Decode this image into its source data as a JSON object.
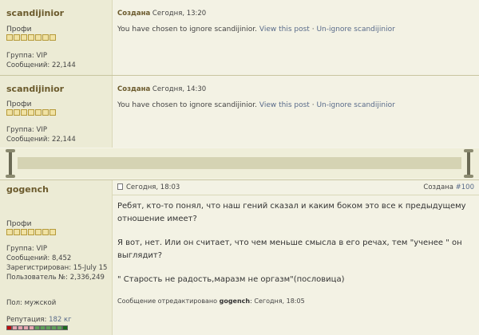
{
  "post1": {
    "username": "scandijinior",
    "rank": "Профи",
    "group": "Группа: VIP",
    "messages": "Сообщений: 22,144",
    "created_label": "Создана",
    "date": " Сегодня, 13:20",
    "ignore_text": "You have chosen to ignore scandijinior.",
    "view_link": "View this post",
    "sep": " · ",
    "unignore_link": "Un-ignore scandijinior"
  },
  "post2": {
    "username": "scandijinior",
    "rank": "Профи",
    "group": "Группа: VIP",
    "messages": "Сообщений: 22,144",
    "created_label": "Создана",
    "date": " Сегодня, 14:30",
    "ignore_text": "You have chosen to ignore scandijinior.",
    "view_link": "View this post",
    "sep": " · ",
    "unignore_link": "Un-ignore scandijinior"
  },
  "post3": {
    "username": "gogench",
    "date": "Сегодня, 18:03",
    "created_label": "Создана",
    "post_number": "#100",
    "rank": "Профи",
    "group": "Группа: VIP",
    "messages": "Сообщений: 8,452",
    "registered": "Зарегистрирован: 15-July 15",
    "user_no": "Пользователь №: 2,336,249",
    "gender": "Пол: мужской",
    "reputation_label": "Репутация:",
    "reputation_value": "182 кг",
    "paragraphs": [
      "Ребят, кто-то понял, что наш гений сказал и каким боком это все к предыдущему отношение имеет?",
      "Я вот, нет. Или он считает, что чем меньше смысла в его речах, тем \"ученее \" он выглядит?",
      "\" Старость не радость,маразм не оргазм\"(пословица)"
    ],
    "edited_prefix": "Сообщение отредактировано",
    "edited_by": "gogench",
    "edited_time": ": Сегодня, 18:05"
  },
  "colors": {
    "username": "#6b5a2c",
    "link": "#596b8a",
    "star_fill": "#f0e2a4",
    "rep_positive": "#5fa15a",
    "rep_negative": "#e6a6b0"
  },
  "icons": {
    "rank_stars": "star-icon",
    "post_icon": "post-icon",
    "scroll_divider": "scroll-divider-icon"
  }
}
